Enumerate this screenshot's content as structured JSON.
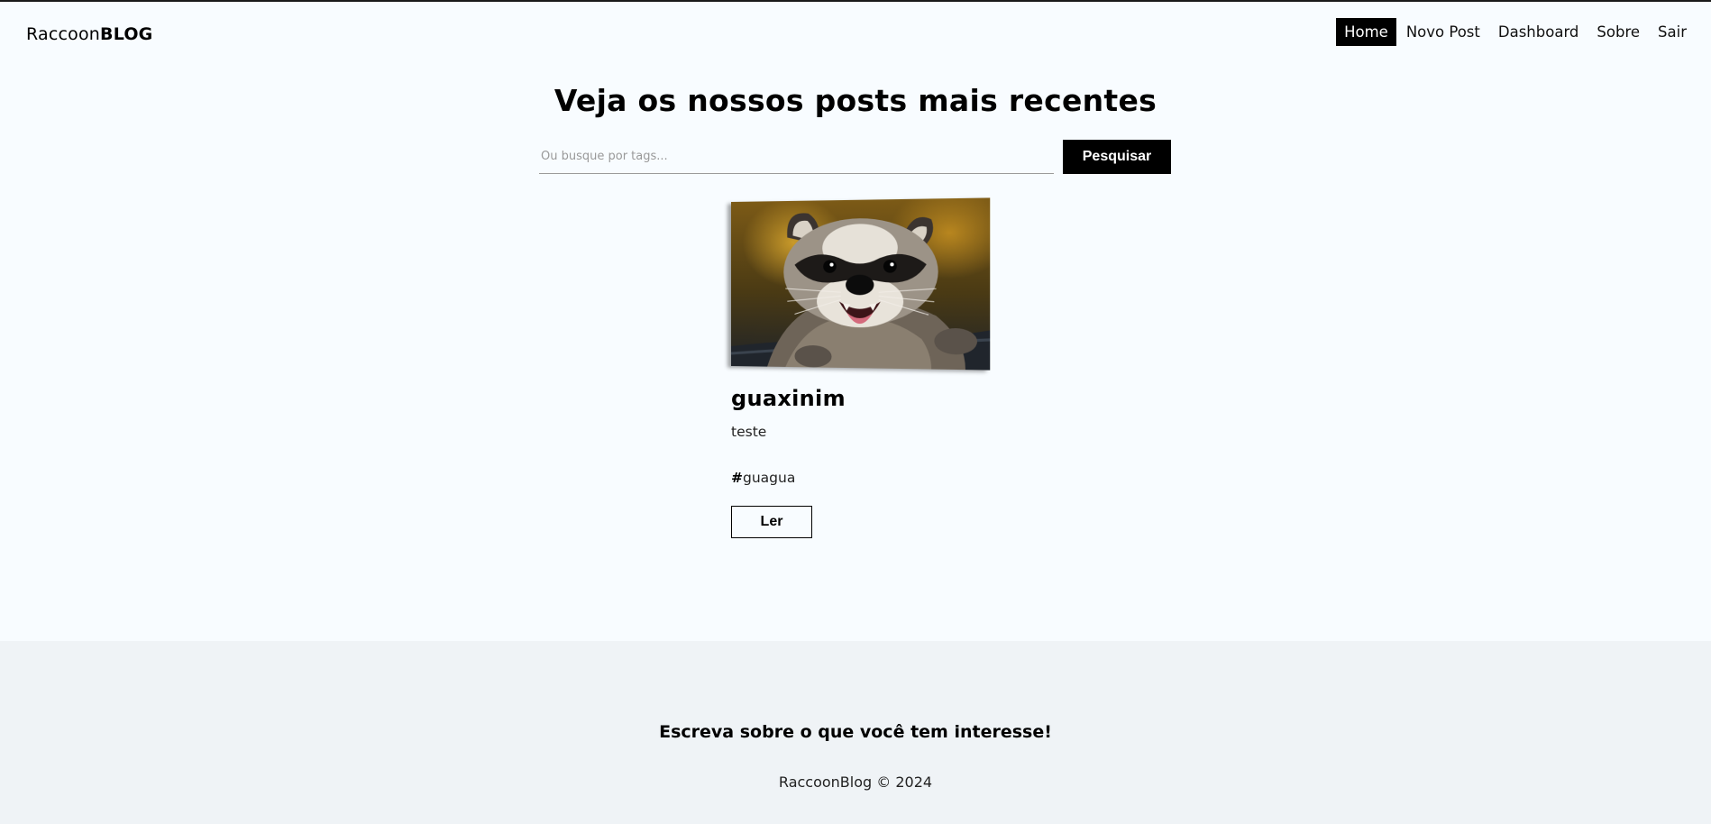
{
  "navbar": {
    "brand_light": "Raccoon",
    "brand_bold": "BLOG",
    "links": [
      {
        "label": "Home",
        "active": true
      },
      {
        "label": "Novo Post",
        "active": false
      },
      {
        "label": "Dashboard",
        "active": false
      },
      {
        "label": "Sobre",
        "active": false
      },
      {
        "label": "Sair",
        "active": false
      }
    ]
  },
  "main": {
    "title": "Veja os nossos posts mais recentes",
    "search": {
      "placeholder": "Ou busque por tags...",
      "value": "",
      "button_label": "Pesquisar"
    }
  },
  "posts": [
    {
      "image_icon": "raccoon-photo",
      "title": "guaxinim",
      "body": "teste",
      "tag_hash": "#",
      "tag": "guagua",
      "read_label": "Ler"
    }
  ],
  "footer": {
    "tagline": "Escreva sobre o que você tem interesse!",
    "copyright": "RaccoonBlog © 2024"
  },
  "colors": {
    "background": "#f8fcff",
    "footer_background": "#eff3f6",
    "accent": "#000000",
    "accent_text": "#ffffff"
  }
}
